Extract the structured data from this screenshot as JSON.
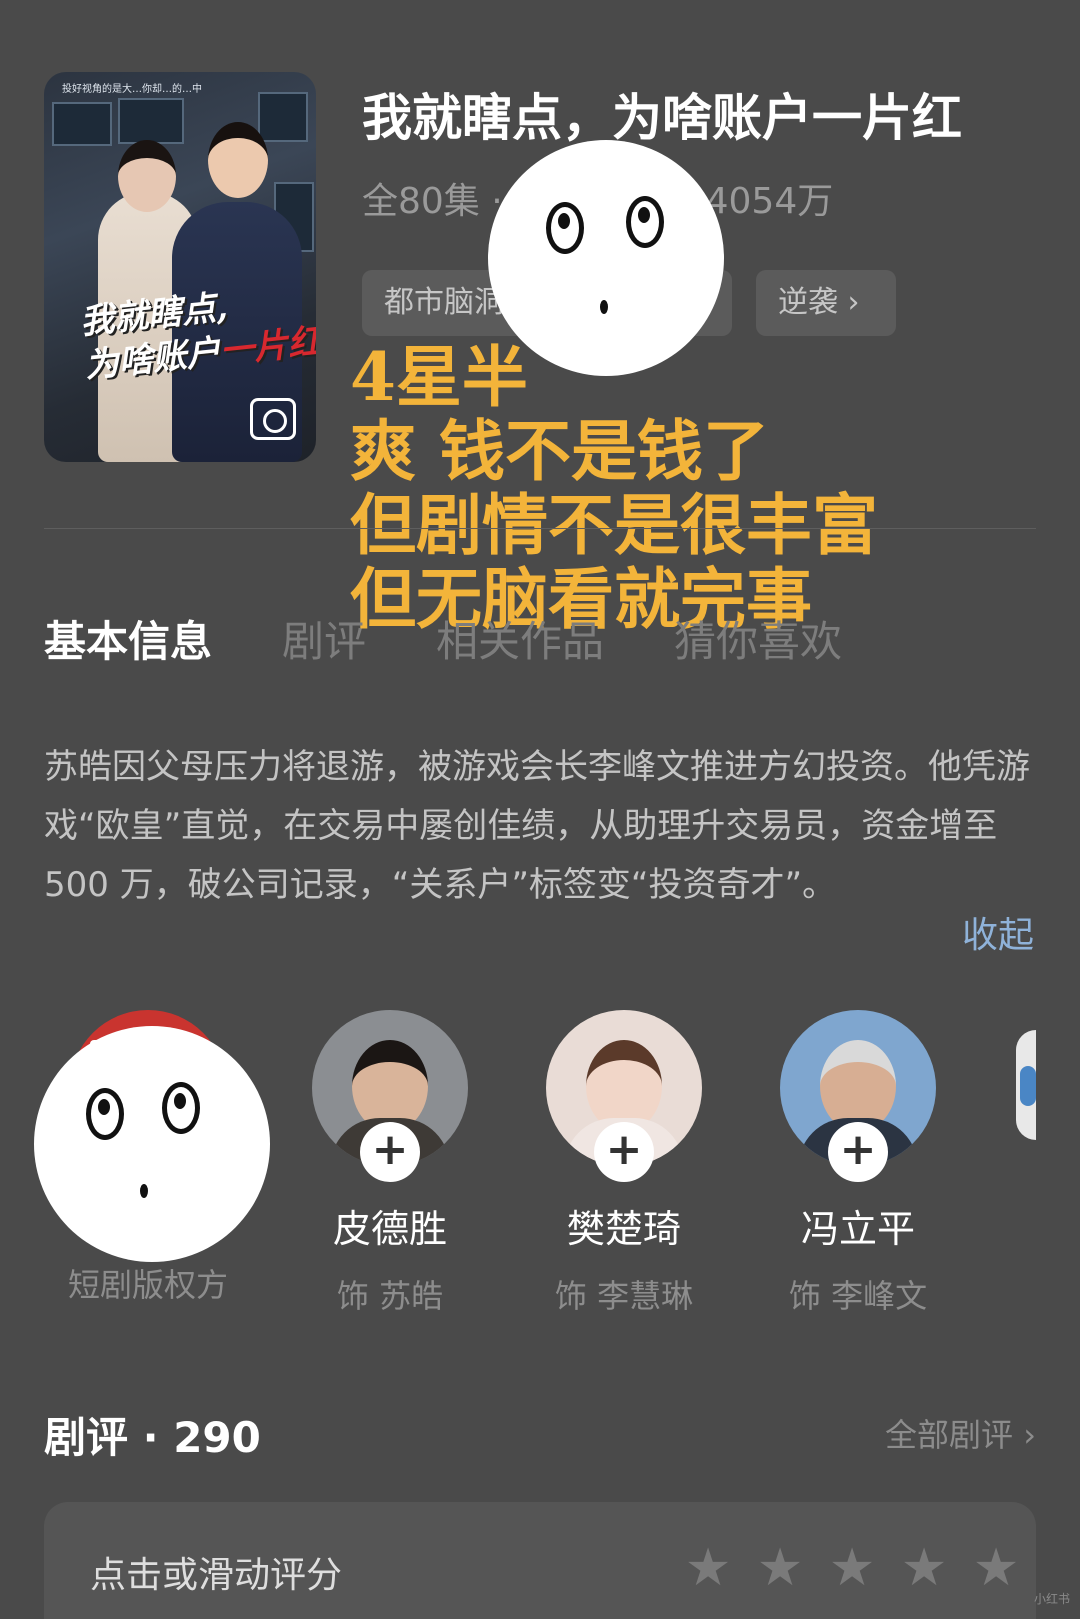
{
  "poster": {
    "top_text": "投好视角的是大…你却…的…中",
    "title_line1": "我就瞎点,",
    "title_line2_prefix": "为啥账户",
    "title_line2_red": "一片红"
  },
  "drama": {
    "title": "我就瞎点，为啥账户一片红",
    "episodes": "全80集",
    "meta_sep": "·",
    "views": "4054万",
    "tags": [
      "都市脑洞",
      "逆袭"
    ],
    "tag_arrow": "›"
  },
  "overlay": {
    "lines": [
      "4星半",
      "爽 钱不是钱了",
      "但剧情不是很丰富",
      "但无脑看就完事"
    ]
  },
  "tabs": [
    "基本信息",
    "剧评",
    "相关作品",
    "猜你喜欢"
  ],
  "synopsis": {
    "text": "苏皓因父母压力将退游，被游戏会长李峰文推进方幻投资。他凭游戏“欧皇”直觉，在交易中屡创佳绩，从助理升交易员，资金增至 500 万，破公司记录，“关系户”标签变“投资奇才”。",
    "collapse": "收起"
  },
  "cast": [
    {
      "name": "",
      "role": "短剧版权方"
    },
    {
      "name": "皮德胜",
      "role": "饰 苏皓"
    },
    {
      "name": "樊楚琦",
      "role": "饰 李慧琳"
    },
    {
      "name": "冯立平",
      "role": "饰 李峰文"
    }
  ],
  "cast_plus": "+",
  "reviews": {
    "title": "剧评 · 290",
    "all": "全部剧评 ›"
  },
  "rating": {
    "label": "点击或滑动评分",
    "stars": 5,
    "value": 0
  },
  "watermark": "小红书",
  "colors": {
    "background": "#4a4a4a",
    "overlay_text": "#f3b43a",
    "link": "#8fb2d9",
    "poster_red": "#d8282f"
  }
}
